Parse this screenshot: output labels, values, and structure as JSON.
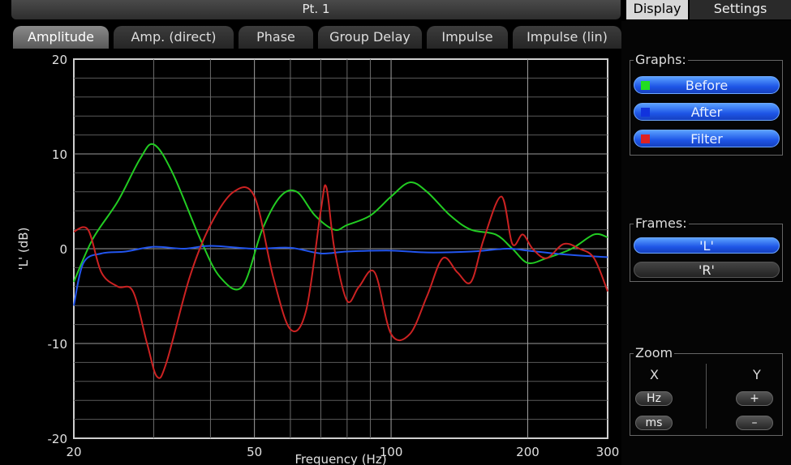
{
  "window": {
    "title": "Pt. 1"
  },
  "tabs": [
    {
      "label": "Amplitude",
      "active": true
    },
    {
      "label": "Amp. (direct)",
      "active": false
    },
    {
      "label": "Phase",
      "active": false
    },
    {
      "label": "Group Delay",
      "active": false
    },
    {
      "label": "Impulse",
      "active": false
    },
    {
      "label": "Impulse (lin)",
      "active": false
    }
  ],
  "side_tabs": [
    {
      "label": "Display",
      "active": true
    },
    {
      "label": "Settings",
      "active": false
    }
  ],
  "graphs": {
    "legend": "Graphs:",
    "items": [
      {
        "label": "Before",
        "swatch_color": "#22dd22"
      },
      {
        "label": "After",
        "swatch_color": "#1133dd"
      },
      {
        "label": "Filter",
        "swatch_color": "#dd2222"
      }
    ]
  },
  "frames": {
    "legend": "Frames:",
    "items": [
      {
        "label": "'L'",
        "selected": true
      },
      {
        "label": "'R'",
        "selected": false
      }
    ]
  },
  "zoom": {
    "legend": "Zoom",
    "x_label": "X",
    "y_label": "Y",
    "x_buttons": [
      "Hz",
      "ms"
    ],
    "y_buttons": [
      "+",
      "–"
    ]
  },
  "chart_data": {
    "type": "line",
    "xlabel": "Frequency (Hz)",
    "ylabel": "'L' (dB)",
    "x_scale": "log",
    "xlim": [
      20,
      300
    ],
    "ylim": [
      -20,
      20
    ],
    "x_ticks": [
      20,
      50,
      100,
      200,
      300
    ],
    "y_ticks": [
      20,
      10,
      0,
      -10,
      -20
    ],
    "grid": true,
    "series": [
      {
        "name": "Before",
        "color": "#22cc22",
        "x": [
          20,
          22,
          25,
          28,
          30,
          33,
          38,
          42,
          47,
          52,
          57,
          62,
          68,
          75,
          80,
          90,
          100,
          110,
          120,
          135,
          150,
          170,
          185,
          200,
          220,
          250,
          280,
          300
        ],
        "y": [
          -3.5,
          1,
          5,
          9.5,
          11,
          8,
          1,
          -3,
          -4,
          2,
          5.5,
          6,
          3.5,
          2,
          2.5,
          3.5,
          5.5,
          7,
          6,
          3.5,
          2,
          1.5,
          0,
          -1.5,
          -1,
          0,
          1.5,
          1.2
        ]
      },
      {
        "name": "After",
        "color": "#2255ee",
        "x": [
          20,
          21,
          23,
          26,
          30,
          35,
          40,
          50,
          60,
          70,
          80,
          100,
          120,
          150,
          180,
          200,
          240,
          300
        ],
        "y": [
          -6,
          -1.5,
          -0.5,
          -0.3,
          0.2,
          0,
          0.3,
          0,
          0.1,
          -0.5,
          -0.3,
          -0.2,
          -0.4,
          -0.3,
          0,
          -0.2,
          -0.6,
          -0.9
        ]
      },
      {
        "name": "Filter",
        "color": "#cc2222",
        "x": [
          20,
          21.5,
          23,
          25,
          27,
          29,
          30.5,
          32,
          36,
          40,
          45,
          50,
          55,
          60,
          65,
          70,
          72,
          75,
          80,
          85,
          92,
          100,
          110,
          120,
          130,
          140,
          150,
          160,
          175,
          185,
          195,
          205,
          220,
          240,
          260,
          280,
          300
        ],
        "y": [
          1.8,
          2,
          -2.5,
          -4,
          -4.5,
          -10,
          -13.5,
          -12,
          -3,
          2.5,
          6,
          5.5,
          -3,
          -8.5,
          -6.5,
          4,
          6.5,
          0,
          -5.5,
          -4,
          -2.5,
          -9,
          -9,
          -5,
          -1,
          -2.5,
          -3.5,
          1,
          5.5,
          0.5,
          1.5,
          0,
          -1,
          0.5,
          0,
          -1,
          -4.5
        ]
      }
    ]
  }
}
